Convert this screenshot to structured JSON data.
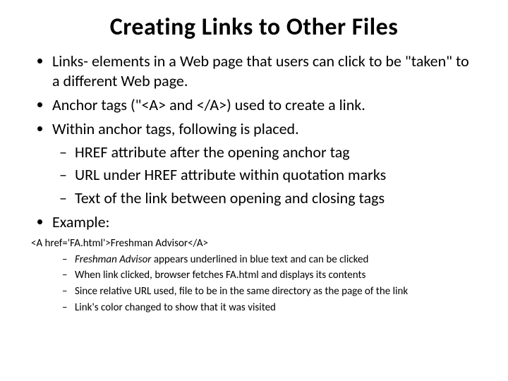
{
  "title": "Creating Links to Other Files",
  "bullets": {
    "b1": "Links- elements in a Web page that users can click to be \"taken\" to a different Web page.",
    "b2": "Anchor  tags (\"<A> and </A>) used to create a link.",
    "b3": "Within anchor tags, following is placed.",
    "b3_sub1": "HREF attribute after the opening anchor tag",
    "b3_sub2": "URL under HREF attribute within quotation marks",
    "b3_sub3": "Text of the link between opening and closing tags",
    "b4": "Example:",
    "code": "<A href='FA.html'>Freshman Advisor</A>",
    "ex_sub1_italic": "Freshman Advisor",
    "ex_sub1_rest": " appears underlined in blue text and can be clicked",
    "ex_sub2": "When link clicked, browser fetches FA.html and displays its contents",
    "ex_sub3": "Since relative URL used, file to be in the same directory as the page of the link",
    "ex_sub4": "Link's color changed to show that it was visited"
  }
}
